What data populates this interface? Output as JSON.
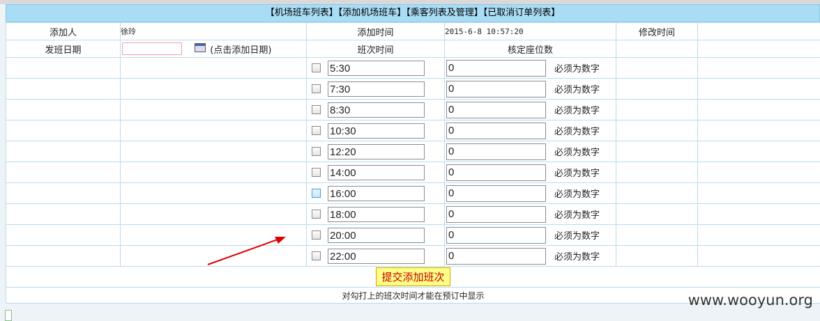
{
  "nav": {
    "text": "【机场班车列表】【添加机场班车】【乘客列表及管理】【已取消订单列表】"
  },
  "info": {
    "adder_label": "添加人",
    "adder_value": "徐玲",
    "added_time_label": "添加时间",
    "added_time_value": "2015-6-8 10:57:20",
    "modified_time_label": "修改时间",
    "depart_date_label": "发班日期",
    "depart_date_value": "",
    "depart_date_hint": "(点击添加日期)",
    "shift_time_label": "班次时间",
    "seat_label": "核定座位数"
  },
  "shifts": [
    {
      "time": "5:30",
      "seats": "0",
      "note": "必须为数字",
      "checked": false
    },
    {
      "time": "7:30",
      "seats": "0",
      "note": "必须为数字",
      "checked": false
    },
    {
      "time": "8:30",
      "seats": "0",
      "note": "必须为数字",
      "checked": false
    },
    {
      "time": "10:30",
      "seats": "0",
      "note": "必须为数字",
      "checked": false
    },
    {
      "time": "12:20",
      "seats": "0",
      "note": "必须为数字",
      "checked": false
    },
    {
      "time": "14:00",
      "seats": "0",
      "note": "必须为数字",
      "checked": false
    },
    {
      "time": "16:00",
      "seats": "0",
      "note": "必须为数字",
      "checked": false
    },
    {
      "time": "18:00",
      "seats": "0",
      "note": "必须为数字",
      "checked": false
    },
    {
      "time": "20:00",
      "seats": "0",
      "note": "必须为数字",
      "checked": false
    },
    {
      "time": "22:00",
      "seats": "0",
      "note": "必须为数字",
      "checked": false
    }
  ],
  "submit_label": "提交添加班次",
  "footer_note": "对勾打上的班次时间才能在预订中显示",
  "watermark": "www.wooyun.org",
  "icons": {
    "calendar": "calendar-icon",
    "arrow": "red-arrow-annotation"
  },
  "colors": {
    "nav_bg": "#a9dcf5",
    "grid_border": "#b9dbec",
    "submit_bg": "#ffff88",
    "submit_text": "#c00000",
    "arrow": "#e00000"
  }
}
